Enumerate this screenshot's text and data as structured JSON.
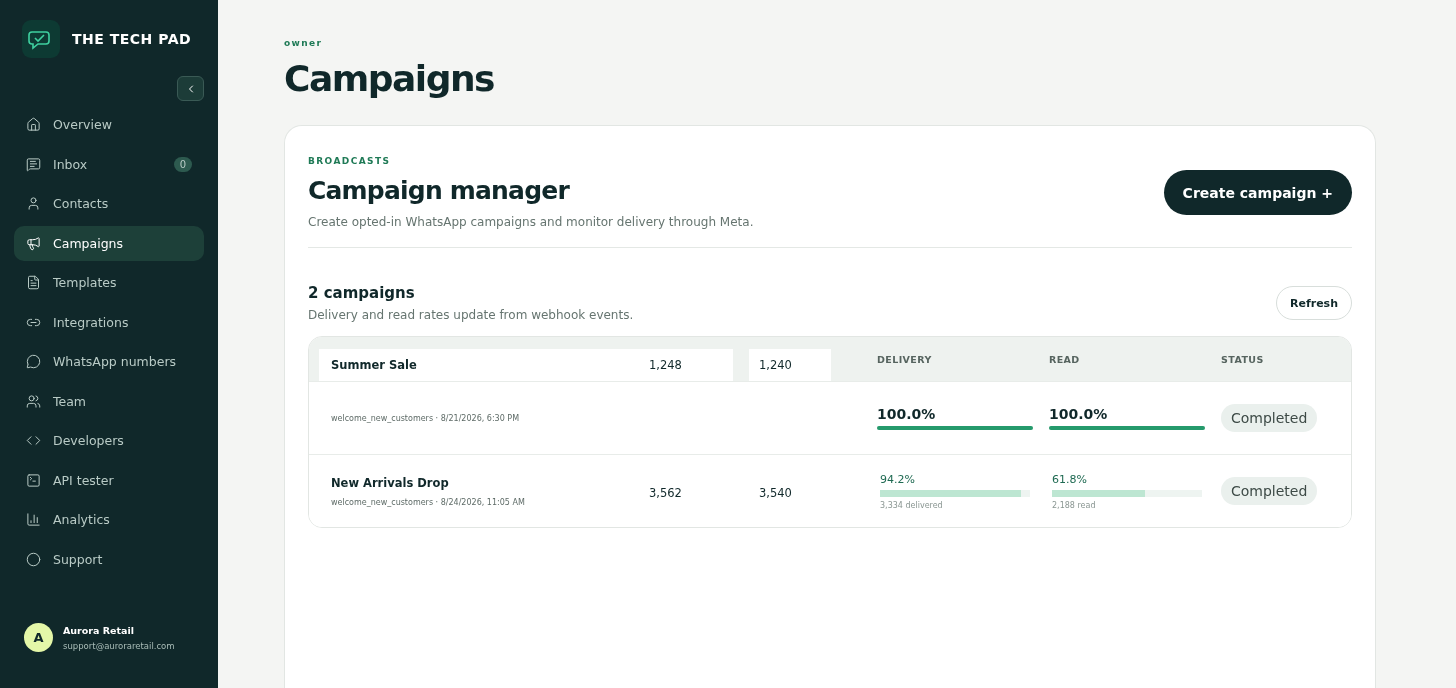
{
  "sidebar": {
    "brand": "THE TECH PAD",
    "items": [
      {
        "label": "Overview",
        "selected": false
      },
      {
        "label": "Inbox",
        "selected": false,
        "badge": "0"
      },
      {
        "label": "Contacts",
        "selected": false
      },
      {
        "label": "Campaigns",
        "selected": true
      },
      {
        "label": "Templates",
        "selected": false
      },
      {
        "label": "Integrations",
        "selected": false
      },
      {
        "label": "WhatsApp numbers",
        "selected": false
      },
      {
        "label": "Team",
        "selected": false
      },
      {
        "label": "Developers",
        "selected": false
      },
      {
        "label": "API tester",
        "selected": false
      },
      {
        "label": "Analytics",
        "selected": false
      },
      {
        "label": "Support",
        "selected": false
      }
    ],
    "account": {
      "initial": "A",
      "name": "Aurora Retail",
      "email": "support@auroraretail.com"
    }
  },
  "page": {
    "eyebrow": "owner",
    "title": "Campaigns"
  },
  "card": {
    "eyebrow": "BROADCASTS",
    "title": "Campaign manager",
    "subtitle": "Create opted-in WhatsApp campaigns and monitor delivery through Meta.",
    "create_button": "Create campaign +",
    "list_title": "2 campaigns",
    "list_subtitle": "Delivery and read rates update from webhook events.",
    "refresh_button": "Refresh"
  },
  "table": {
    "columns": [
      "DELIVERY",
      "READ",
      "STATUS"
    ],
    "rows": [
      {
        "name": "Summer Sale",
        "meta": "welcome_new_customers · 8/21/2026, 6:30 PM",
        "sent": "1,248",
        "delivered": "1,240",
        "kind": "strong",
        "delivery": {
          "rate": "100.0%",
          "level": 1.0
        },
        "read": {
          "rate": "100.0%",
          "level": 1.0
        },
        "status": "Completed"
      },
      {
        "name": "New Arrivals Drop",
        "meta": "welcome_new_customers · 8/24/2026, 11:05 AM",
        "sent": "3,562",
        "delivered": "3,540",
        "kind": "light",
        "delivery": {
          "rate": "94.2%",
          "level": 0.942,
          "note": "3,334 delivered"
        },
        "read": {
          "rate": "61.8%",
          "level": 0.618,
          "note": "2,188 read"
        },
        "status": "Completed"
      }
    ]
  }
}
